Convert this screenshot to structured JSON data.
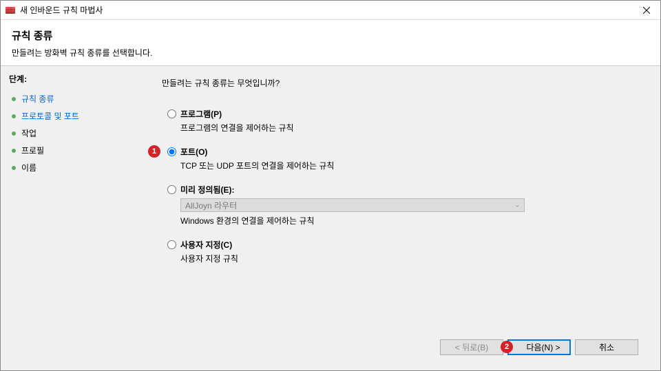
{
  "window": {
    "title": "새 인바운드 규칙 마법사"
  },
  "header": {
    "title": "규칙 종류",
    "subtitle": "만들려는 방화벽 규칙 종류를 선택합니다."
  },
  "sidebar": {
    "heading": "단계:",
    "steps": [
      {
        "label": "규칙 종류",
        "active": true
      },
      {
        "label": "프로토콜 및 포트",
        "active": true
      },
      {
        "label": "작업",
        "active": false
      },
      {
        "label": "프로필",
        "active": false
      },
      {
        "label": "이름",
        "active": false
      }
    ]
  },
  "main": {
    "question": "만들려는 규칙 종류는 무엇입니까?",
    "options": {
      "program": {
        "label": "프로그램(P)",
        "desc": "프로그램의 연결을 제어하는 규칙"
      },
      "port": {
        "label": "포트(O)",
        "desc": "TCP 또는 UDP 포트의 연결을 제어하는 규칙"
      },
      "predefined": {
        "label": "미리 정의됨(E):",
        "combo": "AllJoyn 라우터",
        "desc": "Windows 환경의 연결을 제어하는 규칙"
      },
      "custom": {
        "label": "사용자 지정(C)",
        "desc": "사용자 지정 규칙"
      }
    }
  },
  "footer": {
    "back": "< 뒤로(B)",
    "next": "다음(N) >",
    "cancel": "취소"
  },
  "annotations": {
    "a1": "1",
    "a2": "2"
  }
}
